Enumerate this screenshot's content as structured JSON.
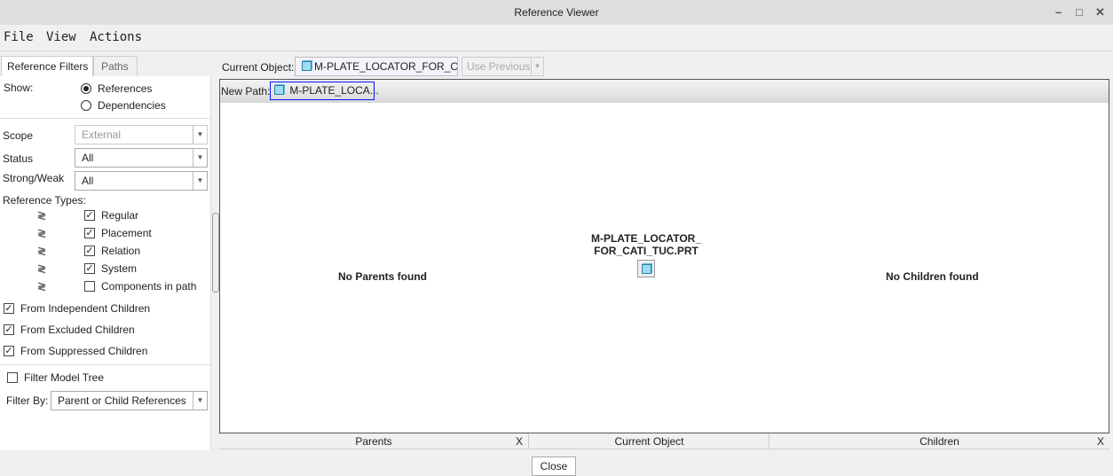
{
  "window": {
    "title": "Reference Viewer",
    "minimize": "–",
    "maximize": "□",
    "close": "✕"
  },
  "menu": [
    "File",
    "View",
    "Actions"
  ],
  "tabs": {
    "filters": "Reference Filters",
    "paths": "Paths"
  },
  "filters": {
    "show_label": "Show:",
    "show_options": [
      {
        "label": "References",
        "selected": true
      },
      {
        "label": "Dependencies",
        "selected": false
      }
    ],
    "scope_label": "Scope",
    "scope_value": "External",
    "status_label": "Status",
    "status_value": "All",
    "strong_label": "Strong/Weak",
    "strong_value": "All",
    "ref_types_label": "Reference Types:",
    "ref_types": [
      {
        "label": "Regular",
        "checked": true
      },
      {
        "label": "Placement",
        "checked": true
      },
      {
        "label": "Relation",
        "checked": true
      },
      {
        "label": "System",
        "checked": true
      },
      {
        "label": "Components in path",
        "checked": false
      }
    ],
    "from": [
      {
        "label": "From Independent Children",
        "checked": true
      },
      {
        "label": "From Excluded Children",
        "checked": true
      },
      {
        "label": "From Suppressed Children",
        "checked": true
      }
    ],
    "filter_model_tree": {
      "label": "Filter Model Tree",
      "checked": false
    },
    "filter_by_label": "Filter By:",
    "filter_by_value": "Parent or Child References"
  },
  "current_object": {
    "label": "Current Object:",
    "value": "M-PLATE_LOCATOR_FOR_CA..",
    "use_previous": "Use Previous"
  },
  "path": {
    "label": "New Path:",
    "value": "M-PLATE_LOCA..."
  },
  "graph": {
    "no_parents": "No Parents found",
    "node_line1": "M-PLATE_LOCATOR_",
    "node_line2": "FOR_CATI_TUC.PRT",
    "no_children": "No Children found"
  },
  "footer": {
    "parents": "Parents",
    "current": "Current Object",
    "children": "Children",
    "close_x": "X",
    "close_button": "Close"
  }
}
